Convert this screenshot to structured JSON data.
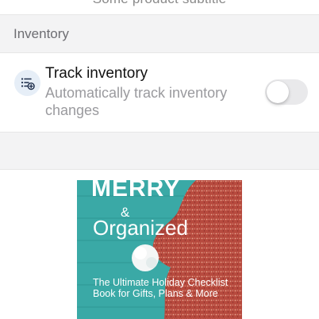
{
  "top": {
    "cut_text": "Some product subtitle"
  },
  "section": {
    "title": "Inventory"
  },
  "track_inventory": {
    "label": "Track inventory",
    "description": "Automatically track inventory changes",
    "enabled": false,
    "icon": "list-add-icon"
  },
  "cover": {
    "title_top": "MERRY",
    "amp": "&",
    "title_main": "Organized",
    "subtitle": "The Ultimate Holiday Checklist Book for Gifts, Plans & More",
    "colors": {
      "background": "#3aa9a6",
      "hat": "#b74a3e"
    }
  },
  "colors": {
    "section_bg": "#f3f3f4",
    "toggle_off": "#e9e9eb",
    "icon_bg": "#e6eef7",
    "icon_fg": "#1c2c4a"
  }
}
